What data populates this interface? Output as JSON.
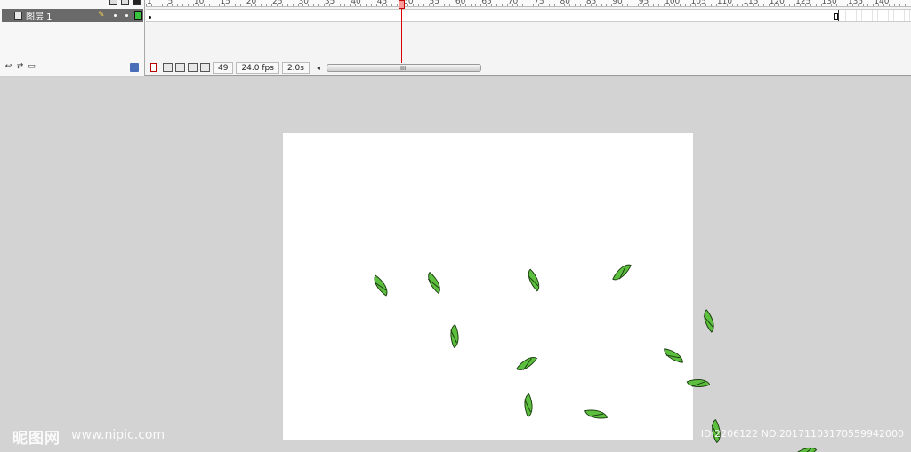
{
  "timeline": {
    "layer_name": "图层 1",
    "ruler_ticks": [
      "1",
      "5",
      "10",
      "15",
      "20",
      "25",
      "30",
      "35",
      "40",
      "45",
      "50",
      "55",
      "60",
      "65",
      "70",
      "75",
      "80",
      "85",
      "90",
      "95",
      "100",
      "105",
      "110",
      "115",
      "120",
      "125",
      "130",
      "135",
      "140"
    ],
    "current_frame": "49",
    "frame_rate": "24.0 fps",
    "elapsed_time": "2.0s",
    "scroll_grip": "III",
    "scroll_left": "◂",
    "layer_tools": [
      "↩",
      "⇄",
      "▭"
    ]
  },
  "watermark": {
    "logo": "昵图网",
    "url": "www.nipic.com",
    "id_text": "ID:2206122 NO:20171103170559942000"
  },
  "colors": {
    "leaf_fill": "#5dbf3e",
    "leaf_outline": "#1c3f12",
    "playhead": "#d80000",
    "layer_outline_swatch": "#39c23b"
  },
  "icons": [
    "eye-icon",
    "lock-icon",
    "outline-icon",
    "layer-icon",
    "pencil-icon",
    "delete-layer-icon",
    "center-frame-icon",
    "onion-skin-icon",
    "onion-skin-outline-icon",
    "edit-multiple-frames-icon",
    "modify-onion-markers-icon"
  ],
  "leaves": 14
}
